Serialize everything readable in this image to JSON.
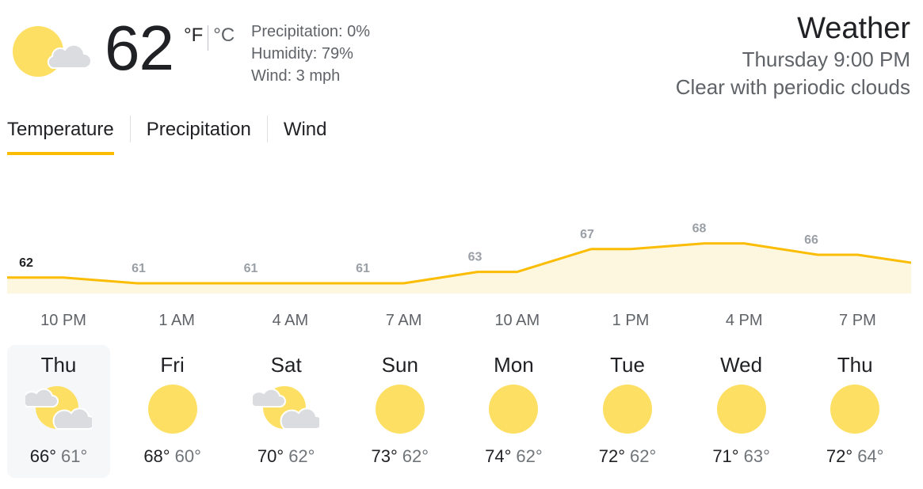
{
  "current": {
    "temperature": "62",
    "unit_f": "°F",
    "unit_c": "°C",
    "precipitation": "Precipitation: 0%",
    "humidity": "Humidity: 79%",
    "wind": "Wind: 3 mph",
    "icon": "sun-behind-cloud-icon"
  },
  "header": {
    "title": "Weather",
    "time": "Thursday 9:00 PM",
    "description": "Clear with periodic clouds"
  },
  "tabs": [
    {
      "label": "Temperature",
      "active": true
    },
    {
      "label": "Precipitation",
      "active": false
    },
    {
      "label": "Wind",
      "active": false
    }
  ],
  "colors": {
    "accent": "#fbbc04",
    "sun": "#fde063",
    "area_fill": "#fef7e0",
    "cloud": "#dadce0"
  },
  "chart_data": {
    "type": "area",
    "x": [
      "10 PM",
      "1 AM",
      "4 AM",
      "7 AM",
      "10 AM",
      "1 PM",
      "4 PM",
      "7 PM"
    ],
    "values": [
      62,
      61,
      61,
      61,
      63,
      67,
      68,
      66
    ],
    "labels": [
      "62",
      "61",
      "61",
      "61",
      "63",
      "67",
      "68",
      "66"
    ],
    "title": "",
    "xlabel": "",
    "ylabel": ""
  },
  "days": [
    {
      "name": "Thu",
      "high": "66°",
      "low": "61°",
      "icon": "partly-cloudy-icon",
      "selected": true
    },
    {
      "name": "Fri",
      "high": "68°",
      "low": "60°",
      "icon": "sunny-icon",
      "selected": false
    },
    {
      "name": "Sat",
      "high": "70°",
      "low": "62°",
      "icon": "partly-cloudy-icon",
      "selected": false
    },
    {
      "name": "Sun",
      "high": "73°",
      "low": "62°",
      "icon": "sunny-icon",
      "selected": false
    },
    {
      "name": "Mon",
      "high": "74°",
      "low": "62°",
      "icon": "sunny-icon",
      "selected": false
    },
    {
      "name": "Tue",
      "high": "72°",
      "low": "62°",
      "icon": "sunny-icon",
      "selected": false
    },
    {
      "name": "Wed",
      "high": "71°",
      "low": "63°",
      "icon": "sunny-icon",
      "selected": false
    },
    {
      "name": "Thu",
      "high": "72°",
      "low": "64°",
      "icon": "sunny-icon",
      "selected": false
    }
  ]
}
